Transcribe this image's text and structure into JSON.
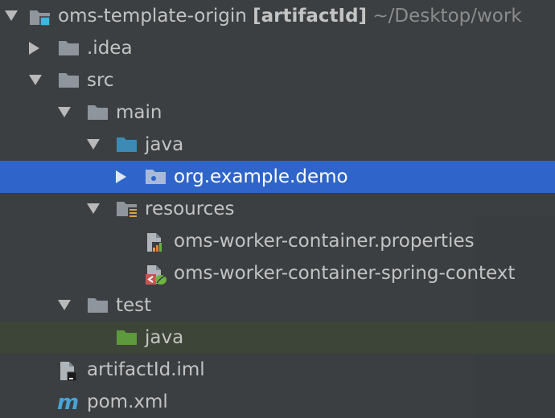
{
  "project_tree": {
    "root": {
      "name": "oms-template-origin",
      "module": "[artifactId]",
      "path": "~/Desktop/work"
    },
    "items": [
      {
        "label": ".idea"
      },
      {
        "label": "src"
      },
      {
        "label": "main"
      },
      {
        "label": "java"
      },
      {
        "label": "org.example.demo"
      },
      {
        "label": "resources"
      },
      {
        "label": "oms-worker-container.properties"
      },
      {
        "label": "oms-worker-container-spring-context"
      },
      {
        "label": "test"
      },
      {
        "label": "java"
      },
      {
        "label": "artifactId.iml"
      },
      {
        "label": "pom.xml"
      }
    ]
  },
  "colors": {
    "background": "#3c3f41",
    "selection": "#2f65ca",
    "hover_row": "#3d4438",
    "folder_gray": "#8e959c",
    "source_folder_blue": "#3d8bb4",
    "test_folder_green": "#5d9a3e",
    "maven_blue": "#4aa3d8"
  },
  "icons": {
    "root": "module-folder-icon",
    "folder": "folder-icon",
    "source_folder": "source-folder-icon",
    "package": "package-icon",
    "resources_folder": "resources-folder-icon",
    "properties_file": "properties-file-icon",
    "spring_xml_file": "spring-xml-file-icon",
    "test_folder": "test-source-folder-icon",
    "iml_file": "iml-file-icon",
    "maven_file": "maven-pom-icon"
  }
}
